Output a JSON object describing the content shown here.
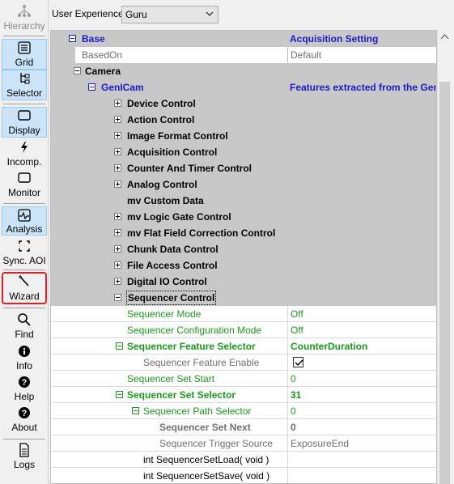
{
  "toolbar": {
    "hierarchy": "Hierarchy",
    "grid": "Grid",
    "selector": "Selector",
    "display": "Display",
    "incomp": "Incomp.",
    "monitor": "Monitor",
    "analysis": "Analysis",
    "sync_aoi": "Sync. AOI",
    "wizard": "Wizard",
    "find": "Find",
    "info": "Info",
    "help": "Help",
    "about": "About",
    "logs": "Logs"
  },
  "topbar": {
    "ux_label": "User Experience:",
    "ux_value": "Guru"
  },
  "grid": {
    "rows": [
      {
        "name": "Base",
        "value": "Acquisition Setting"
      },
      {
        "name": "BasedOn",
        "value": "Default"
      },
      {
        "name": "Camera",
        "value": ""
      },
      {
        "name": "GenICam",
        "value": "Features extracted from the Gen"
      },
      {
        "name": "Device Control",
        "value": ""
      },
      {
        "name": "Action Control",
        "value": ""
      },
      {
        "name": "Image Format Control",
        "value": ""
      },
      {
        "name": "Acquisition Control",
        "value": ""
      },
      {
        "name": "Counter And Timer Control",
        "value": ""
      },
      {
        "name": "Analog Control",
        "value": ""
      },
      {
        "name": "mv Custom Data",
        "value": ""
      },
      {
        "name": "mv Logic Gate Control",
        "value": ""
      },
      {
        "name": "mv Flat Field Correction Control",
        "value": ""
      },
      {
        "name": "Chunk Data Control",
        "value": ""
      },
      {
        "name": "File Access Control",
        "value": ""
      },
      {
        "name": "Digital IO Control",
        "value": ""
      },
      {
        "name": "Sequencer Control",
        "value": ""
      },
      {
        "name": "Sequencer Mode",
        "value": "Off"
      },
      {
        "name": "Sequencer Configuration Mode",
        "value": "Off"
      },
      {
        "name": "Sequencer Feature Selector",
        "value": "CounterDuration"
      },
      {
        "name": "Sequencer Feature Enable",
        "value": ""
      },
      {
        "name": "Sequencer Set Start",
        "value": "0"
      },
      {
        "name": "Sequencer Set Selector",
        "value": "31"
      },
      {
        "name": "Sequencer Path Selector",
        "value": "0"
      },
      {
        "name": "Sequencer Set Next",
        "value": "0"
      },
      {
        "name": "Sequencer Trigger Source",
        "value": "ExposureEnd"
      },
      {
        "name": "int SequencerSetLoad( void )",
        "value": ""
      },
      {
        "name": "int SequencerSetSave( void )",
        "value": ""
      }
    ]
  }
}
